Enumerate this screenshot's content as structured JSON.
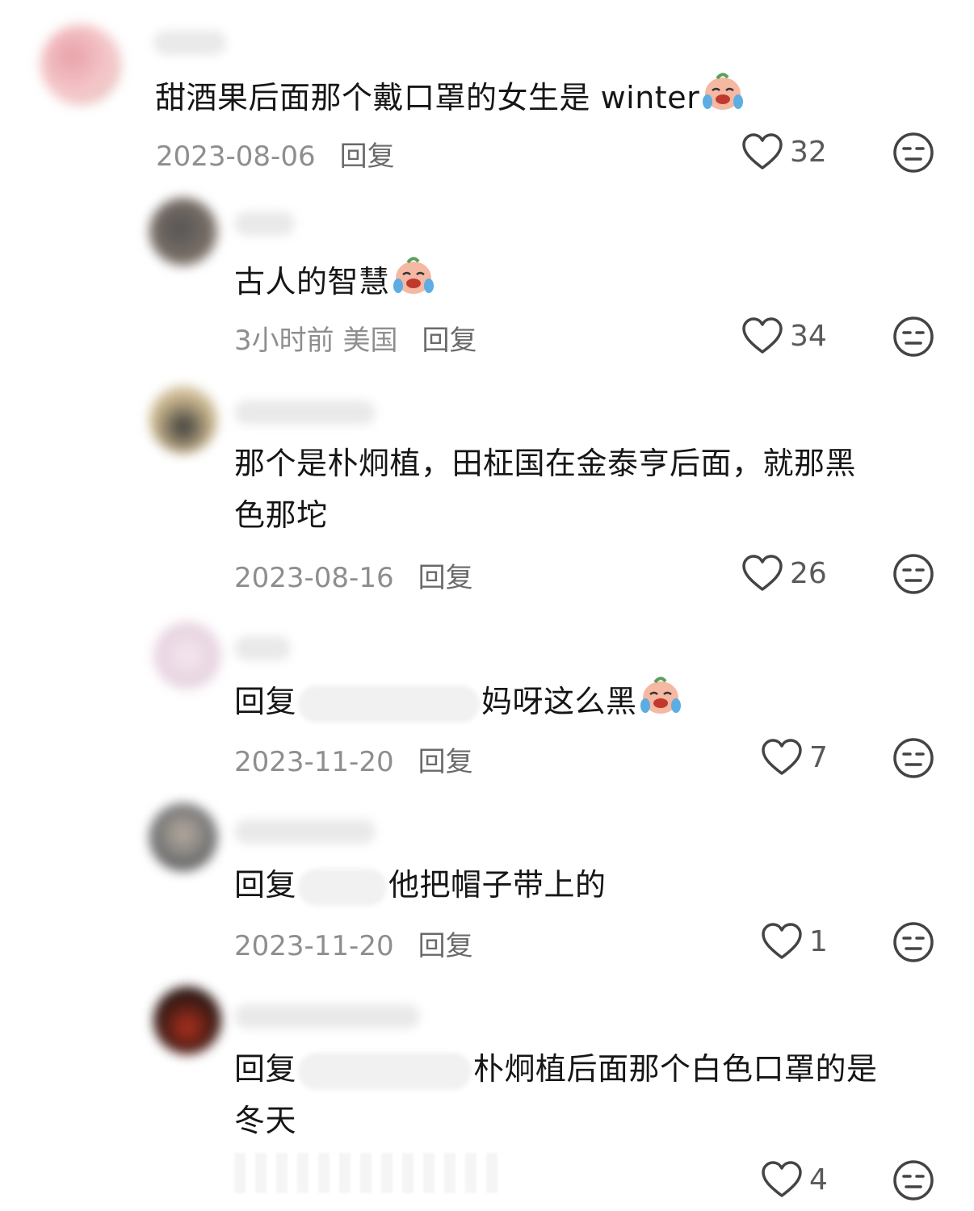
{
  "comments": [
    {
      "text": "甜酒果后面那个戴口罩的女生是 winter",
      "meta": "2023-08-06",
      "reply": "回复",
      "likes": "32",
      "emoji": "crying-laugh-emoji"
    },
    {
      "text": "古人的智慧",
      "meta": "3小时前 美国",
      "reply": "回复",
      "likes": "34",
      "emoji": "crying-laugh-emoji"
    },
    {
      "text_line1": "那个是朴炯植，田柾国在金泰亨后面，就那黑",
      "text_line2": "色那坨",
      "meta": "2023-08-16",
      "reply": "回复",
      "likes": "26"
    },
    {
      "text_prefix": "回复",
      "text": "妈呀这么黑",
      "meta": "2023-11-20",
      "reply": "回复",
      "likes": "7",
      "emoji": "crying-laugh-emoji"
    },
    {
      "text_prefix": "回复",
      "text": "他把帽子带上的",
      "meta": "2023-11-20",
      "reply": "回复",
      "likes": "1"
    },
    {
      "text_prefix": "回复",
      "text_line1": "朴炯植后面那个白色口罩的是",
      "text_line2": "冬天",
      "likes": "4"
    }
  ],
  "colors": {
    "text": "#161616",
    "meta": "#8e8e8e",
    "icon": "#444444"
  }
}
